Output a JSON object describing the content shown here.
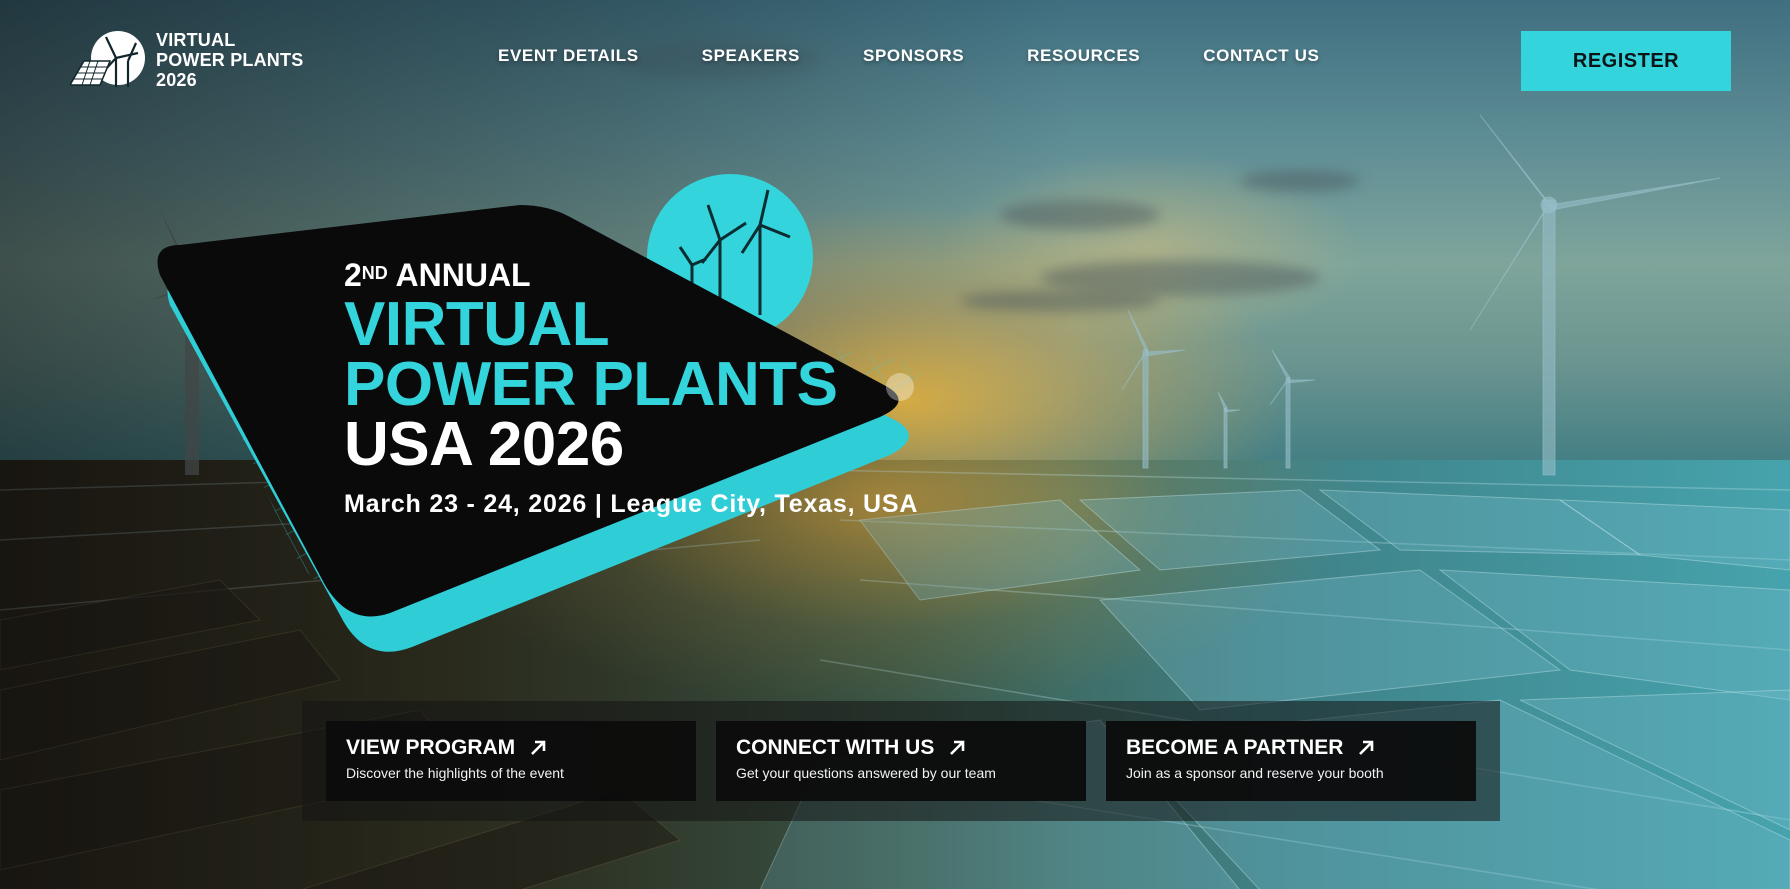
{
  "header": {
    "logo": {
      "line1": "VIRTUAL",
      "line2": "POWER PLANTS",
      "line3": "2026"
    },
    "nav": [
      {
        "label": "EVENT DETAILS"
      },
      {
        "label": "SPEAKERS"
      },
      {
        "label": "SPONSORS"
      },
      {
        "label": "RESOURCES"
      },
      {
        "label": "CONTACT US"
      }
    ],
    "register_label": "REGISTER"
  },
  "hero": {
    "annual_number": "2",
    "annual_suffix": "ND",
    "annual_word": "ANNUAL",
    "title_line1": "VIRTUAL",
    "title_line2": "POWER PLANTS",
    "title_line3": "USA 2026",
    "dates": "March 23 - 24, 2026 | League City, Texas, USA"
  },
  "cta": [
    {
      "title": "VIEW PROGRAM",
      "desc": "Discover the highlights of the event"
    },
    {
      "title": "CONNECT WITH US",
      "desc": "Get your questions answered by our team"
    },
    {
      "title": "BECOME A PARTNER",
      "desc": "Join as a sponsor and reserve your booth"
    }
  ],
  "icons": {
    "logo": "wind-turbine-solar-logo-icon",
    "cta_arrow": "arrow-up-right-icon",
    "hero_badge": "wind-turbines-icon"
  },
  "colors": {
    "accent": "#34d4dc",
    "badge_dark": "#0a0a0a",
    "cta_bg": "#0c0c0c"
  }
}
